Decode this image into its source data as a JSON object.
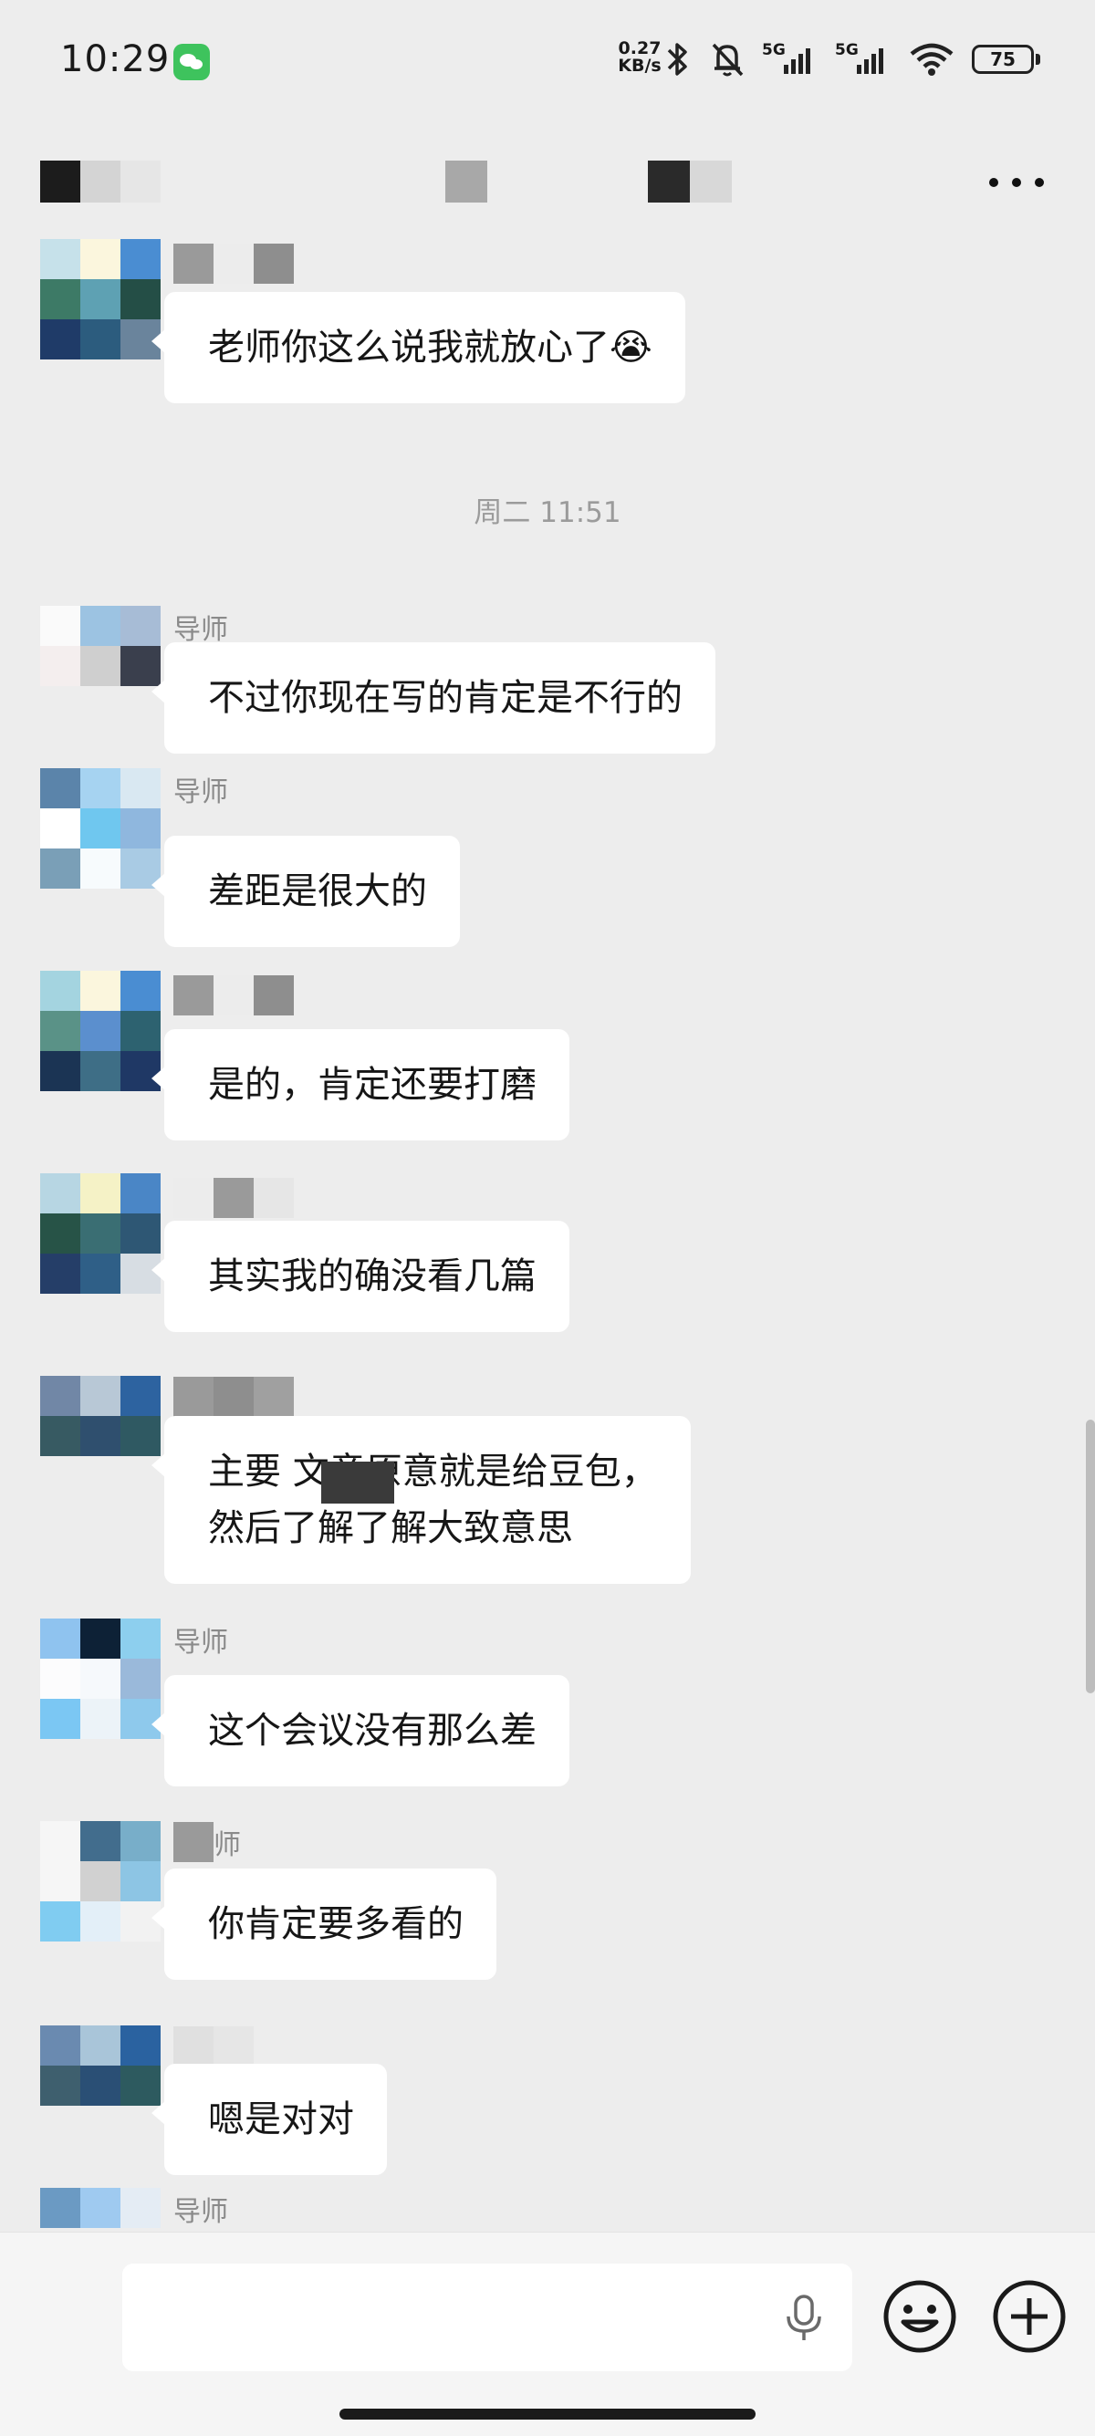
{
  "status_bar": {
    "time": "10:29",
    "net_speed_value": "0.27",
    "net_speed_unit": "KB/s",
    "sim1_label": "5G",
    "sim2_label": "5G",
    "battery": "75",
    "icons": [
      "wechat-notification-icon",
      "bluetooth-icon",
      "mute-bell-icon",
      "signal-icon",
      "signal-icon",
      "wifi-icon",
      "battery-icon"
    ]
  },
  "header": {
    "more_icon": "more-dots-icon"
  },
  "timestamp": "周二 11:51",
  "messages": [
    {
      "sender": "",
      "text": "老师你这么说我就放心了😭"
    },
    {
      "sender": "导师",
      "text": "不过你现在写的肯定是不行的"
    },
    {
      "sender": "导师",
      "text": "差距是很大的"
    },
    {
      "sender": "",
      "text": "是的，肯定还要打磨"
    },
    {
      "sender": "",
      "text": "其实我的确没看几篇"
    },
    {
      "sender": "",
      "text": "主要         文章原意就是给豆包，\n然后了解了解大致意思"
    },
    {
      "sender": "导师",
      "text": "这个会议没有那么差"
    },
    {
      "sender": "师",
      "text": "你肯定要多看的"
    },
    {
      "sender": "",
      "text": "嗯是对对"
    },
    {
      "sender": "导师",
      "text": ""
    }
  ],
  "input": {
    "value": "",
    "mic_icon": "microphone-icon",
    "emoji_icon": "emoji-icon",
    "plus_icon": "plus-icon"
  }
}
